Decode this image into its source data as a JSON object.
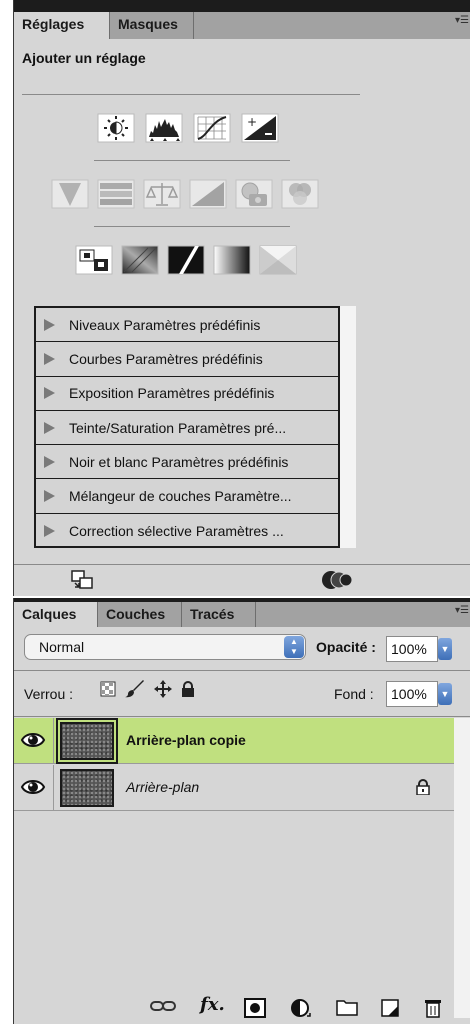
{
  "adjustments_panel": {
    "tabs": [
      {
        "label": "Réglages",
        "active": true
      },
      {
        "label": "Masques",
        "active": false
      }
    ],
    "title": "Ajouter un réglage",
    "icon_rows": [
      [
        "brightness-contrast-icon",
        "levels-icon",
        "curves-icon",
        "exposure-icon"
      ],
      [
        "vibrance-icon",
        "hue-saturation-icon",
        "color-balance-icon",
        "black-white-icon",
        "photo-filter-icon",
        "channel-mixer-icon"
      ],
      [
        "invert-icon",
        "posterize-icon",
        "threshold-icon",
        "gradient-map-icon",
        "selective-color-icon"
      ]
    ],
    "presets": [
      "Niveaux Paramètres prédéfinis",
      "Courbes Paramètres prédéfinis",
      "Exposition Paramètres prédéfinis",
      "Teinte/Saturation Paramètres pré...",
      "Noir et blanc Paramètres prédéfinis",
      "Mélangeur de couches Paramètre...",
      "Correction sélective Paramètres ..."
    ]
  },
  "layers_panel": {
    "tabs": [
      {
        "label": "Calques",
        "active": true
      },
      {
        "label": "Couches",
        "active": false
      },
      {
        "label": "Tracés",
        "active": false
      }
    ],
    "blend_mode": "Normal",
    "opacity_label": "Opacité :",
    "opacity_value": "100%",
    "lock_label": "Verrou :",
    "fill_label": "Fond :",
    "fill_value": "100%",
    "layers": [
      {
        "name": "Arrière-plan copie",
        "selected": true,
        "locked": false
      },
      {
        "name": "Arrière-plan",
        "selected": false,
        "locked": true
      }
    ],
    "selected_color": "#c0e07f"
  }
}
